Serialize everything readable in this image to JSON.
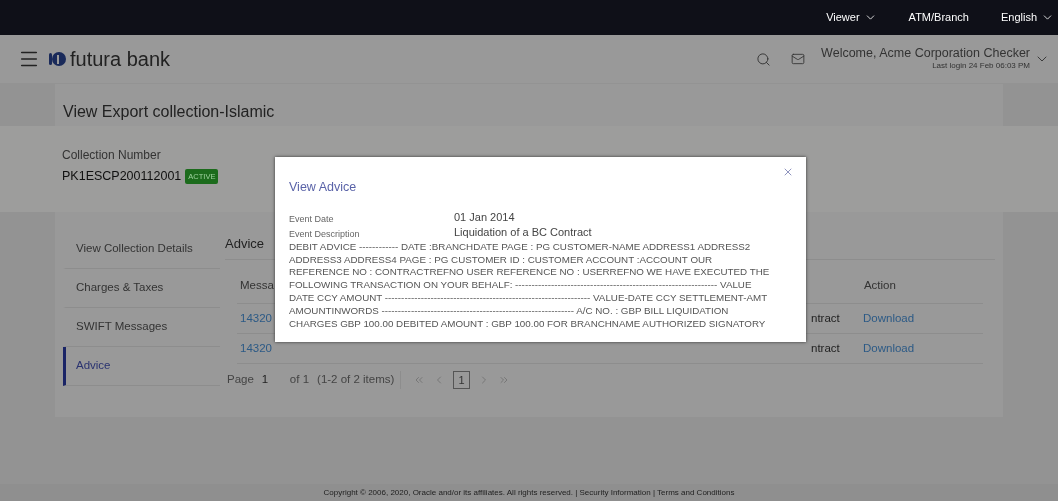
{
  "top_bar": {
    "items": [
      {
        "label": "Viewer",
        "has_menu": true
      },
      {
        "label": "ATM/Branch",
        "has_menu": false
      },
      {
        "label": "English",
        "has_menu": true
      }
    ]
  },
  "header": {
    "brand": "futura bank",
    "welcome": "Welcome, Acme Corporation Checker",
    "last_login": "Last login 24 Feb 06:03 PM"
  },
  "page": {
    "title": "View Export collection-Islamic",
    "summary": [
      {
        "label": "Collection Number",
        "value": "PK1ESCP200112001",
        "badge": "ACTIVE"
      }
    ],
    "nav": [
      {
        "label": "View Collection Details",
        "selected": false
      },
      {
        "label": "Charges & Taxes",
        "selected": false
      },
      {
        "label": "SWIFT Messages",
        "selected": false
      },
      {
        "label": "Advice",
        "selected": true
      }
    ],
    "section_title": "Advice",
    "table": {
      "columns": [
        "Messa",
        "Action"
      ],
      "rows": [
        {
          "column_1": "14320",
          "column_3": "ntract",
          "action": "Download"
        },
        {
          "column_1": "14320",
          "column_3": "ntract",
          "action": "Download"
        }
      ]
    },
    "pagination": {
      "page_label": "Page",
      "page": "1",
      "of": "of 1",
      "items": "(1-2 of 2 items)",
      "current": "1"
    }
  },
  "modal": {
    "title": "View Advice",
    "fields": [
      {
        "label": "Event Date",
        "value": "01 Jan 2014"
      },
      {
        "label": "Event Description",
        "value": "Liquidation of a BC Contract"
      }
    ],
    "body": "DEBIT ADVICE ------------ DATE :BRANCHDATE PAGE : PG CUSTOMER-NAME ADDRESS1 ADDRESS2 ADDRESS3 ADDRESS4 PAGE : PG CUSTOMER ID : CUSTOMER ACCOUNT :ACCOUNT OUR REFERENCE NO : CONTRACTREFNO USER REFERENCE NO : USERREFNO WE HAVE EXECUTED THE FOLLOWING TRANSACTION ON YOUR BEHALF: -------------------------------------------------------------- VALUE DATE CCY AMOUNT --------------------------------------------------------------- VALUE-DATE CCY SETTLEMENT-AMT AMOUNTINWORDS ----------------------------------------------------------- A/C NO. : GBP BILL LIQUIDATION CHARGES GBP 100.00 DEBITED AMOUNT : GBP 100.00 FOR BRANCHNAME AUTHORIZED SIGNATORY"
  },
  "footer": {
    "text": "Copyright © 2006, 2020, Oracle and/or its affiliates. All rights reserved. | Security Information | Terms and Conditions"
  }
}
